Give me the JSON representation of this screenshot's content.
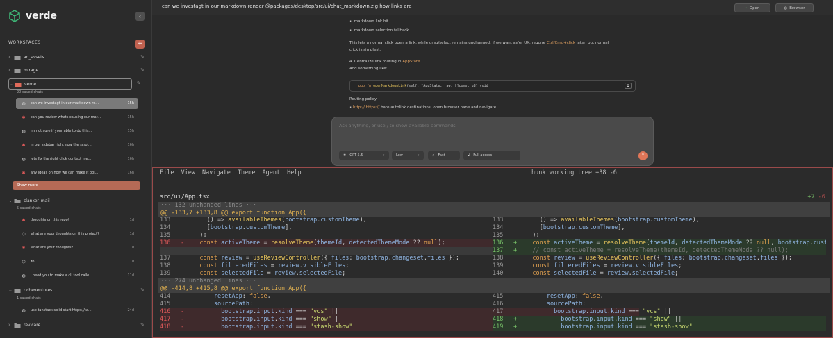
{
  "app": {
    "name": "verde"
  },
  "sidebar": {
    "workspaces_label": "WORKSPACES",
    "workspaces": [
      {
        "name": "ad_assets"
      },
      {
        "name": "mirage"
      },
      {
        "name": "verde",
        "count": "20 saved chats",
        "chats": [
          {
            "title": "can we investagt in our markdown re...",
            "meta": "15h",
            "icon": "globe-icon"
          },
          {
            "title": "can you review whats causing our mar...",
            "meta": "15h",
            "icon": "bug-icon"
          },
          {
            "title": "im not sure if your able to do this...",
            "meta": "15h",
            "icon": "globe-icon"
          },
          {
            "title": "in our sidebar right now the scrol...",
            "meta": "16h",
            "icon": "bug-icon"
          },
          {
            "title": "lets fix the right click context me...",
            "meta": "16h",
            "icon": "globe-icon"
          },
          {
            "title": "any ideas on how we can make it obi...",
            "meta": "16h",
            "icon": "bug-icon"
          }
        ],
        "show_more": "Show more"
      },
      {
        "name": "clanker_mail",
        "count": "5 saved chats",
        "chats": [
          {
            "title": "thoughts on this repo?",
            "meta": "1d",
            "icon": "bug-icon"
          },
          {
            "title": "what are your thoughts on this project?",
            "meta": "1d",
            "icon": "cube-icon"
          },
          {
            "title": "what are your thoughts?",
            "meta": "1d",
            "icon": "bug-icon"
          },
          {
            "title": "Yo",
            "meta": "1d",
            "icon": "cube-icon"
          },
          {
            "title": "i need you to make a cli tool calle...",
            "meta": "11d",
            "icon": "globe-icon"
          }
        ]
      },
      {
        "name": "richeventures",
        "count": "1 saved chats",
        "chats": [
          {
            "title": "use tanstack solid start https://ta...",
            "meta": "24d",
            "icon": "globe-icon"
          }
        ]
      },
      {
        "name": "revicare"
      }
    ]
  },
  "top": {
    "title": "can we investagt in our markdown render @packages/desktop/src/ui/chat_markdown.zig how links are",
    "open": "Open",
    "browser": "Browser"
  },
  "chat": {
    "lines": [
      "markdown link hit",
      "markdown selection fallback",
      "This lets a normal click open a link, while drag/select remains unchanged. If we want safer UX, require",
      "later, but normal",
      "click is simplest.",
      "4. Centralize link routing in",
      "Add something like:",
      "Routing policy:",
      "bare autolink destinations: open browser pane and navigate."
    ],
    "inline_code": {
      "modifier": "Ctrl/Cmd+click",
      "appstate": "AppState",
      "urls": "http:// https://"
    },
    "code": {
      "kw": "pub fn",
      "fn": "openMarkdownLink",
      "rest": "(self: *AppState, raw: []const u8) void"
    },
    "composer_placeholder": "Ask anything, or use / to show available commands",
    "model": "GPT-5.5",
    "effort": "Low",
    "fast": "Fast",
    "access": "Full access"
  },
  "terminal": {
    "menu": [
      "File",
      "View",
      "Navigate",
      "Theme",
      "Agent",
      "Help"
    ],
    "status": "hunk working tree  +38  -6",
    "file": "src/ui/App.tsx",
    "added": "+7",
    "removed": "-6",
    "unchanged1": "··· 132 unchanged lines ···",
    "hunk1": "@@ -133,7 +133,8 @@ export function App({",
    "unchanged2": "··· 274 unchanged lines ···",
    "hunk2": "@@ -414,8 +415,8 @@ export function App({"
  },
  "colors": {
    "accent": "#e07658",
    "del": "#e05a5a",
    "add": "#7ac46a",
    "border": "#9a4a4a"
  }
}
